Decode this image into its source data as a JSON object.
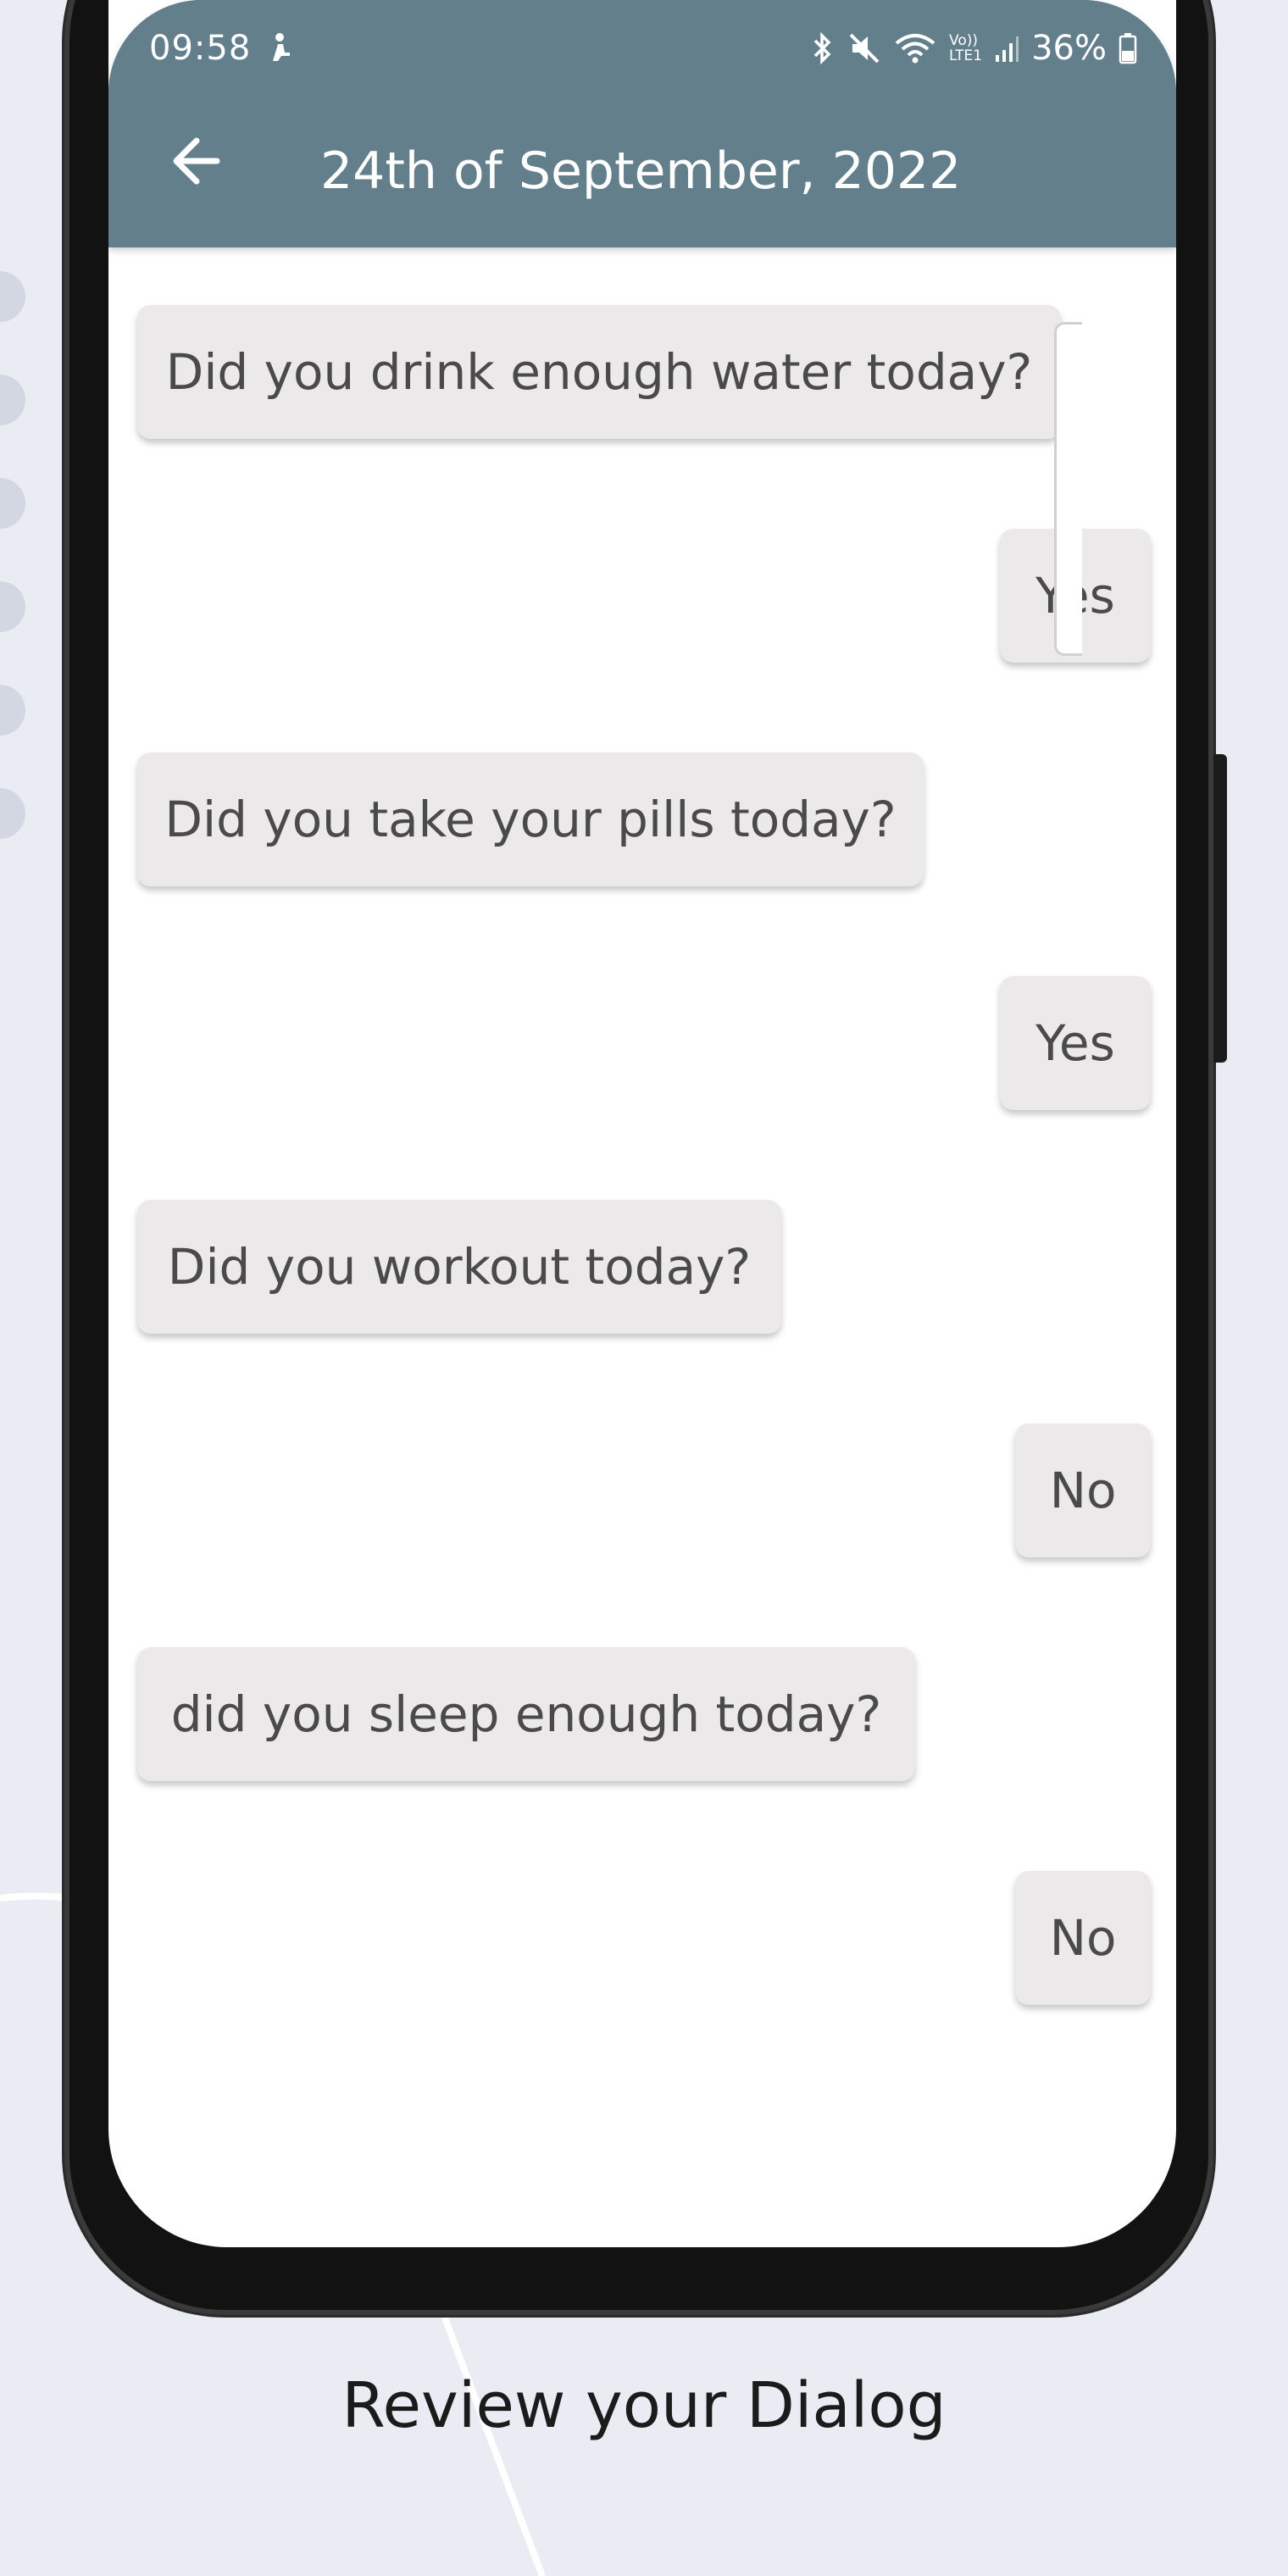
{
  "status_bar": {
    "time": "09:58",
    "battery": "36%",
    "volte_label_top": "Vo))",
    "volte_label_bottom": "LTE1"
  },
  "header": {
    "title": "24th of September, 2022",
    "back_icon": "arrow-left-icon"
  },
  "dialog": [
    {
      "speaker": "app",
      "text": "Did you drink enough water today?"
    },
    {
      "speaker": "user",
      "text": "Yes"
    },
    {
      "speaker": "app",
      "text": "Did you take your pills today?"
    },
    {
      "speaker": "user",
      "text": "Yes"
    },
    {
      "speaker": "app",
      "text": "Did you workout today?"
    },
    {
      "speaker": "user",
      "text": "No"
    },
    {
      "speaker": "app",
      "text": "did you sleep enough today?"
    },
    {
      "speaker": "user",
      "text": "No"
    }
  ],
  "caption": "Review your Dialog",
  "colors": {
    "header": "#637f8c",
    "bubble": "#ebe9ea",
    "background": "#e9ecf3"
  }
}
